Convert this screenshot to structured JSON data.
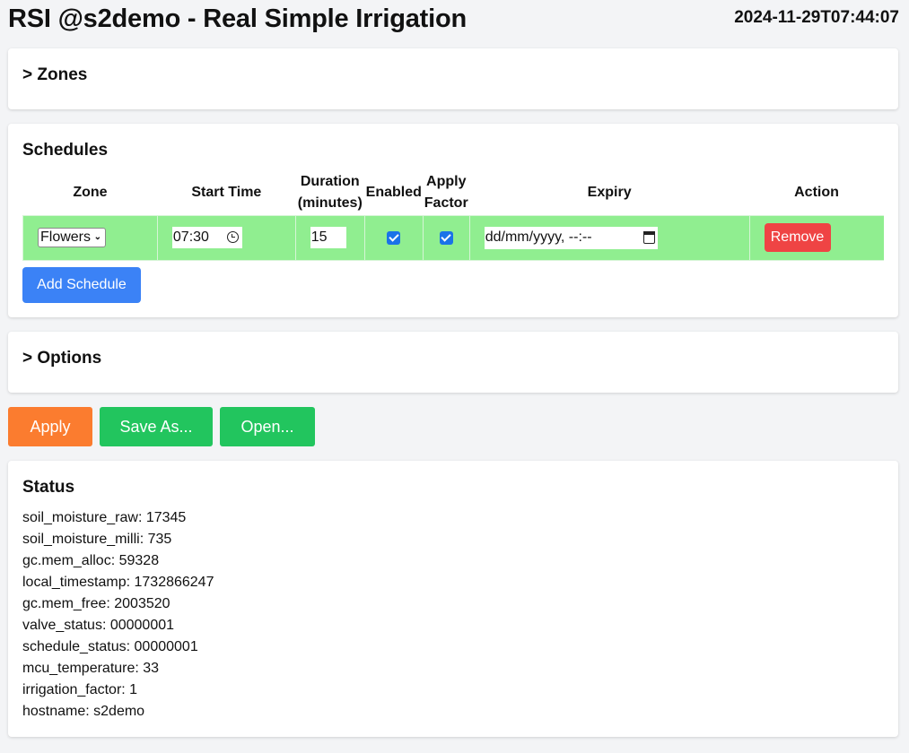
{
  "header": {
    "title": "RSI @s2demo - Real Simple Irrigation",
    "clock": "2024-11-29T07:44:07"
  },
  "zones": {
    "title": "> Zones"
  },
  "schedules": {
    "title": "Schedules",
    "columns": [
      "Zone",
      "Start Time",
      "Duration (minutes)",
      "Enabled",
      "Apply Factor",
      "Expiry",
      "Action"
    ],
    "rows": [
      {
        "zone": "Flowers",
        "start_time": "07:30",
        "duration": "15",
        "enabled": true,
        "apply_factor": true,
        "expiry_placeholder": "dd/mm/yyyy, --:--",
        "action_label": "Remove"
      }
    ],
    "add_label": "Add Schedule",
    "row_color": "#90ee90"
  },
  "options": {
    "title": "> Options"
  },
  "actions": {
    "apply_label": "Apply",
    "save_as_label": "Save As...",
    "open_label": "Open...",
    "apply_color": "#fb7c2f",
    "save_color": "#22c55e"
  },
  "status": {
    "title": "Status",
    "lines": [
      "soil_moisture_raw: 17345",
      "soil_moisture_milli: 735",
      "gc.mem_alloc: 59328",
      "local_timestamp: 1732866247",
      "gc.mem_free: 2003520",
      "valve_status: 00000001",
      "schedule_status: 00000001",
      "mcu_temperature: 33",
      "irrigation_factor: 1",
      "hostname: s2demo"
    ]
  }
}
